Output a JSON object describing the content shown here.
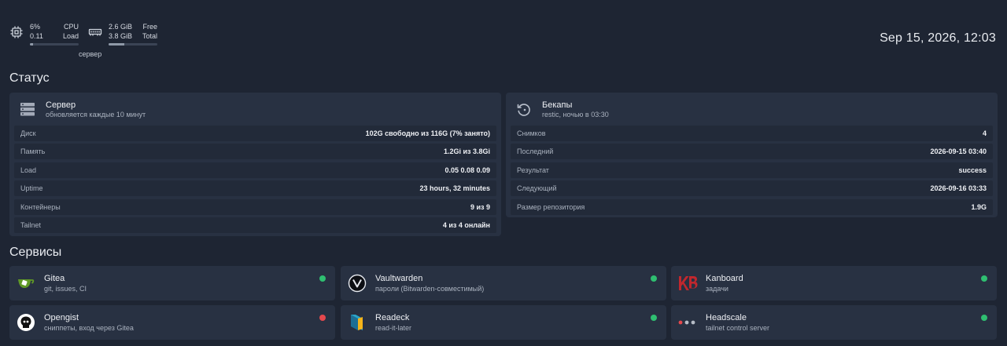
{
  "top": {
    "cpu": {
      "percent": "6%",
      "load_value": "0.11",
      "label_top": "CPU",
      "label_bottom": "Load",
      "fill": 0.06
    },
    "mem": {
      "free": "2.6 GiB",
      "total": "3.8 GiB",
      "label_top": "Free",
      "label_bottom": "Total",
      "fill": 0.32
    },
    "host": "сервер",
    "clock": "Sep 15, 2026, 12:03"
  },
  "status": {
    "title": "Статус",
    "server": {
      "name": "Сервер",
      "desc": "обновляется каждые 10 минут",
      "icon": "server-icon",
      "rows": [
        {
          "k": "Диск",
          "v": "102G свободно из 116G (7% занято)"
        },
        {
          "k": "Память",
          "v": "1.2Gi из 3.8Gi"
        },
        {
          "k": "Load",
          "v": "0.05 0.08 0.09"
        },
        {
          "k": "Uptime",
          "v": "23 hours, 32 minutes"
        },
        {
          "k": "Контейнеры",
          "v": "9 из 9"
        },
        {
          "k": "Tailnet",
          "v": "4 из 4 онлайн"
        }
      ]
    },
    "backups": {
      "name": "Бекапы",
      "desc": "restic, ночью в 03:30",
      "icon": "restore-icon",
      "rows": [
        {
          "k": "Снимков",
          "v": "4"
        },
        {
          "k": "Последний",
          "v": "2026-09-15 03:40"
        },
        {
          "k": "Результат",
          "v": "success"
        },
        {
          "k": "Следующий",
          "v": "2026-09-16 03:33"
        },
        {
          "k": "Размер репозитория",
          "v": "1.9G"
        }
      ]
    }
  },
  "services": {
    "title": "Сервисы",
    "items": [
      {
        "name": "Gitea",
        "desc": "git, issues, CI",
        "status": "up",
        "status_color": "#2fbf71",
        "icon": "gitea-icon"
      },
      {
        "name": "Vaultwarden",
        "desc": "пароли (Bitwarden-совместимый)",
        "status": "up",
        "status_color": "#2fbf71",
        "icon": "vaultwarden-icon"
      },
      {
        "name": "Kanboard",
        "desc": "задачи",
        "status": "up",
        "status_color": "#2fbf71",
        "icon": "kanboard-icon"
      },
      {
        "name": "Opengist",
        "desc": "сниппеты, вход через Gitea",
        "status": "down",
        "status_color": "#e5484d",
        "icon": "opengist-icon"
      },
      {
        "name": "Readeck",
        "desc": "read-it-later",
        "status": "up",
        "status_color": "#2fbf71",
        "icon": "readeck-icon"
      },
      {
        "name": "Headscale",
        "desc": "tailnet control server",
        "status": "up",
        "status_color": "#2fbf71",
        "icon": "headscale-icon"
      }
    ]
  },
  "colors": {
    "bg": "#1e2533",
    "card": "#283142",
    "up": "#2fbf71",
    "down": "#e5484d"
  }
}
